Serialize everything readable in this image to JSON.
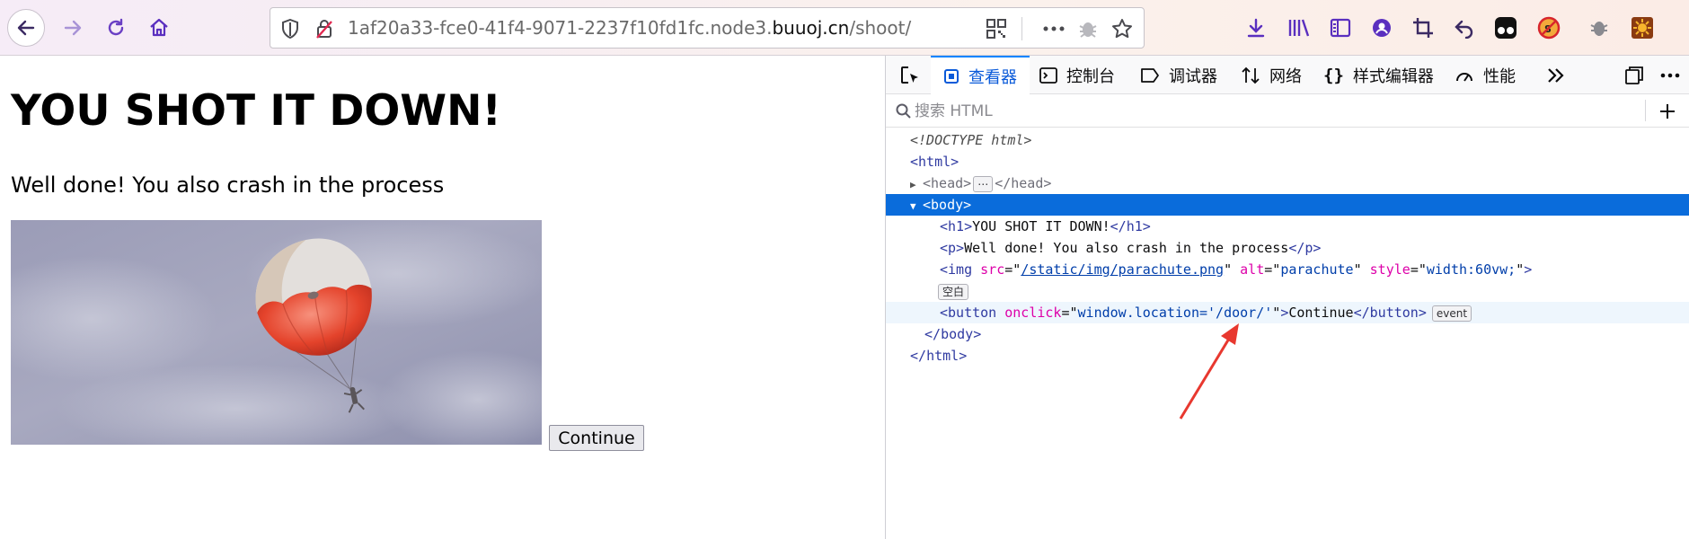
{
  "browser": {
    "url_prefix": "1af20a33-fce0-41f4-9071-2237f10fd1fc.node3.",
    "url_host": "buuoj.cn",
    "url_path": "/shoot/"
  },
  "page": {
    "heading": "YOU SHOT IT DOWN!",
    "paragraph": "Well done! You also crash in the process",
    "image_alt": "parachute",
    "continue_label": "Continue"
  },
  "devtools": {
    "tabs": [
      {
        "label": "查看器"
      },
      {
        "label": "控制台"
      },
      {
        "label": "调试器"
      },
      {
        "label": "网络"
      },
      {
        "label": "样式编辑器"
      },
      {
        "label": "性能"
      }
    ],
    "search_placeholder": "搜索 HTML",
    "markup": {
      "doctype": "<!DOCTYPE html>",
      "html_open": "html",
      "head": "head",
      "body": "body",
      "h1_text": "YOU SHOT IT DOWN!",
      "p_text": "Well done! You also crash in the process",
      "img_src": "/static/img/parachute.png",
      "img_alt": "parachute",
      "img_style": "width:60vw;",
      "whitespace_badge": "空白",
      "button_onclick": "window.location='/door/'",
      "button_text": "Continue",
      "event_badge": "event",
      "ellipsis_badge": "⋯"
    }
  },
  "colors": {
    "selected_row": "#0a6cdb",
    "active_tab": "#0a84ff",
    "annotation_arrow": "#e8382f"
  }
}
